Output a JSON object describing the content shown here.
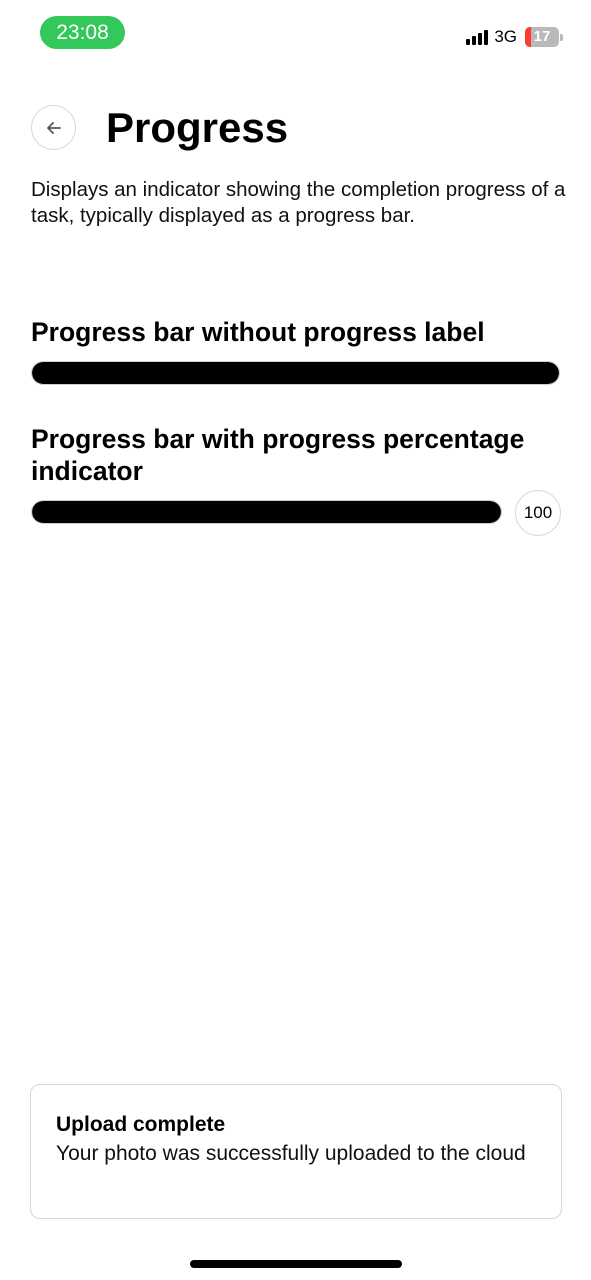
{
  "status_bar": {
    "time": "23:08",
    "network": "3G",
    "battery_level": "17",
    "battery_fraction": 0.17,
    "time_pill_color": "#34c759",
    "battery_low_color": "#ff3b30"
  },
  "header": {
    "back_icon": "arrow-left-icon",
    "title": "Progress"
  },
  "description": "Displays an indicator showing the completion progress of a task, typically displayed as a progress bar.",
  "sections": [
    {
      "title": "Progress bar without progress label",
      "progress_percent": 100
    },
    {
      "title": "Progress bar with progress percentage indicator",
      "progress_percent": 100,
      "indicator_label": "100"
    }
  ],
  "toast": {
    "title": "Upload complete",
    "message": "Your photo was successfully uploaded to the cloud"
  }
}
